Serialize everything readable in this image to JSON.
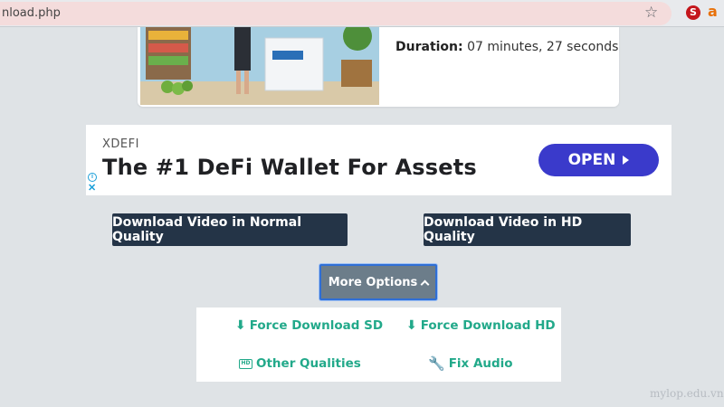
{
  "browser": {
    "url": "nload.php",
    "star_icon": "star-icon",
    "extensions": [
      {
        "name": "extension-s-icon",
        "glyph": "S",
        "color": "#c4161c"
      },
      {
        "name": "extension-a-icon",
        "glyph": "a",
        "color": "#e8710a"
      }
    ]
  },
  "video": {
    "duration_label": "Duration:",
    "duration_value": "07 minutes, 27 seconds"
  },
  "ad": {
    "brand": "XDEFI",
    "headline": "The #1 DeFi Wallet For Assets",
    "cta_label": "OPEN",
    "cta_color": "#3a3acb"
  },
  "downloads": {
    "normal_label": "Download Video in Normal Quality",
    "hd_label": "Download Video in HD Quality",
    "button_color": "#243447"
  },
  "more_options": {
    "label": "More Options"
  },
  "options": {
    "accent_color": "#22a98a",
    "force_sd": "Force Download SD",
    "force_hd": "Force Download HD",
    "other_qualities": "Other Qualities",
    "fix_audio": "Fix Audio"
  },
  "watermark": "mylop.edu.vn"
}
